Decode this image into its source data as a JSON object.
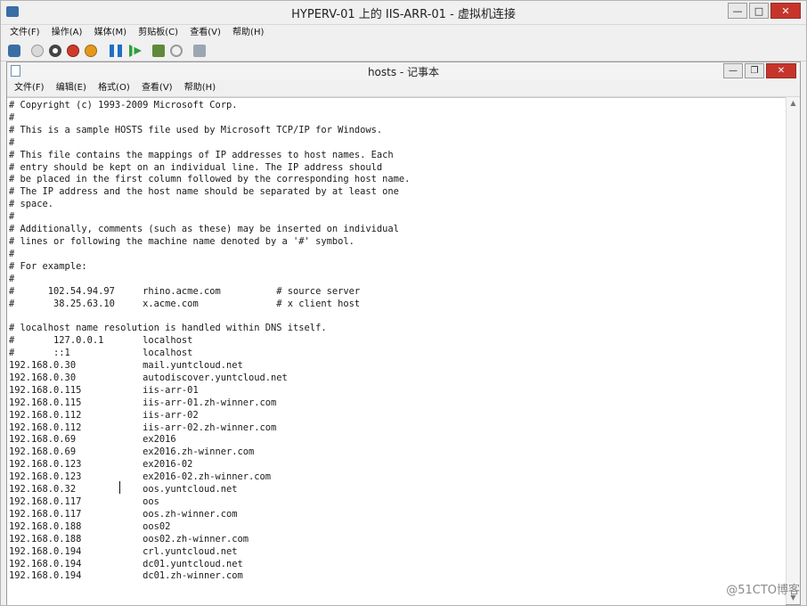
{
  "vm_window": {
    "title": "HYPERV-01 上的 IIS-ARR-01 - 虚拟机连接",
    "menu": [
      "文件(F)",
      "操作(A)",
      "媒体(M)",
      "剪贴板(C)",
      "查看(V)",
      "帮助(H)"
    ],
    "toolbar_icons": [
      "ctrl-alt-del-icon",
      "start-icon",
      "turn-off-icon",
      "shutdown-icon",
      "save-icon",
      "pause-icon",
      "reset-icon",
      "snapshot-icon",
      "revert-icon",
      "enhanced-session-icon"
    ],
    "colors": {
      "pause": "#1f6fc4",
      "reset": "#2e9e3a",
      "shutdown": "#d03a2a",
      "save": "#e39a1c"
    }
  },
  "notepad": {
    "title": "hosts - 记事本",
    "menu": [
      "文件(F)",
      "编辑(E)",
      "格式(O)",
      "查看(V)",
      "帮助(H)"
    ],
    "content": "# Copyright (c) 1993-2009 Microsoft Corp.\n#\n# This is a sample HOSTS file used by Microsoft TCP/IP for Windows.\n#\n# This file contains the mappings of IP addresses to host names. Each\n# entry should be kept on an individual line. The IP address should\n# be placed in the first column followed by the corresponding host name.\n# The IP address and the host name should be separated by at least one\n# space.\n#\n# Additionally, comments (such as these) may be inserted on individual\n# lines or following the machine name denoted by a '#' symbol.\n#\n# For example:\n#\n#      102.54.94.97     rhino.acme.com          # source server\n#       38.25.63.10     x.acme.com              # x client host\n\n# localhost name resolution is handled within DNS itself.\n#       127.0.0.1       localhost\n#       ::1             localhost\n192.168.0.30            mail.yuntcloud.net\n192.168.0.30            autodiscover.yuntcloud.net\n192.168.0.115           iis-arr-01\n192.168.0.115           iis-arr-01.zh-winner.com\n192.168.0.112           iis-arr-02\n192.168.0.112           iis-arr-02.zh-winner.com\n192.168.0.69            ex2016\n192.168.0.69            ex2016.zh-winner.com\n192.168.0.123           ex2016-02\n192.168.0.123           ex2016-02.zh-winner.com\n192.168.0.32            oos.yuntcloud.net\n192.168.0.117           oos\n192.168.0.117           oos.zh-winner.com\n192.168.0.188           oos02\n192.168.0.188           oos02.zh-winner.com\n192.168.0.194           crl.yuntcloud.net\n192.168.0.194           dc01.yuntcloud.net\n192.168.0.194           dc01.zh-winner.com"
  },
  "watermark": "@51CTO博客"
}
